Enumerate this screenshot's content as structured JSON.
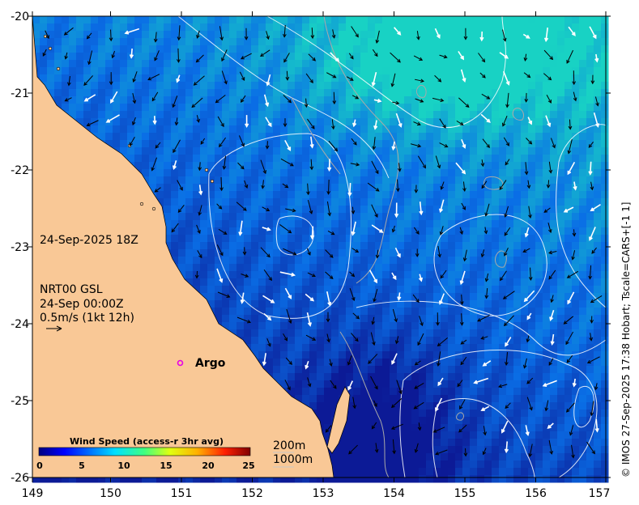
{
  "map": {
    "bounds": {
      "lon": [
        149,
        157
      ],
      "lat": [
        -26,
        -20
      ]
    },
    "x_ticks": [
      "149",
      "150",
      "151",
      "152",
      "153",
      "154",
      "155",
      "156",
      "157"
    ],
    "y_ticks": [
      "-20",
      "-21",
      "-22",
      "-23",
      "-24",
      "-25",
      "-26"
    ],
    "colors": {
      "land": "#f9c896",
      "ocean_deep": "#0c1a96",
      "ocean_mid": "#0a6ee6",
      "ocean_light": "#18d2c4",
      "contour": "#ffffff",
      "isobath": "#a9a9a9"
    }
  },
  "annotations": {
    "date": "24-Sep-2025 18Z",
    "product": "NRT00 GSL",
    "product_time": "24-Sep 00:00Z",
    "scale_label": "0.5m/s (1kt 12h)"
  },
  "argo": {
    "label": "Argo",
    "lon": 150.99,
    "lat": -24.54,
    "color": "#e600e6"
  },
  "colorbar": {
    "title": "Wind Speed (access-r 3hr avg)",
    "ticks": [
      "0",
      "5",
      "10",
      "15",
      "20",
      "25"
    ],
    "range": [
      0,
      25
    ]
  },
  "isobaths": {
    "label_200": "200m",
    "label_1000": "1000m"
  },
  "credit": "© IMOS 27-Sep-2025 17:38 Hobart; Tscale=CARS+[-1 1]"
}
